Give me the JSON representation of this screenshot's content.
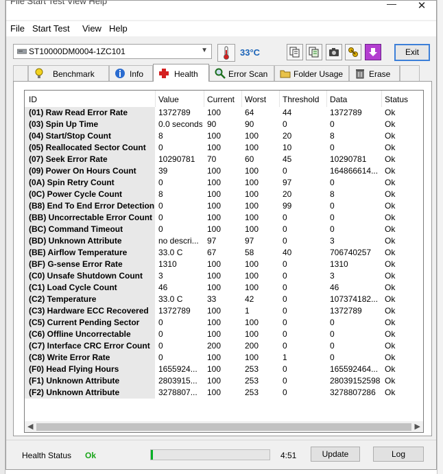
{
  "window": {
    "title": "File  Start Test  View  Help"
  },
  "menu": [
    "File",
    "Start Test",
    "View",
    "Help"
  ],
  "toolbar": {
    "drive": "ST10000DM0004-1ZC101",
    "temperature": "33°C",
    "exit_label": "Exit"
  },
  "tabs": [
    "Benchmark",
    "Info",
    "Health",
    "Error Scan",
    "Folder Usage",
    "Erase"
  ],
  "active_tab": "Health",
  "table": {
    "columns": [
      "ID",
      "Value",
      "Current",
      "Worst",
      "Threshold",
      "Data",
      "Status"
    ],
    "rows": [
      [
        "(01) Raw Read Error Rate",
        "1372789",
        "100",
        "64",
        "44",
        "1372789",
        "Ok"
      ],
      [
        "(03) Spin Up Time",
        "0.0 seconds",
        "90",
        "90",
        "0",
        "0",
        "Ok"
      ],
      [
        "(04) Start/Stop Count",
        "8",
        "100",
        "100",
        "20",
        "8",
        "Ok"
      ],
      [
        "(05) Reallocated Sector Count",
        "0",
        "100",
        "100",
        "10",
        "0",
        "Ok"
      ],
      [
        "(07) Seek Error Rate",
        "10290781",
        "70",
        "60",
        "45",
        "10290781",
        "Ok"
      ],
      [
        "(09) Power On Hours Count",
        "39",
        "100",
        "100",
        "0",
        "164866614...",
        "Ok"
      ],
      [
        "(0A) Spin Retry Count",
        "0",
        "100",
        "100",
        "97",
        "0",
        "Ok"
      ],
      [
        "(0C) Power Cycle Count",
        "8",
        "100",
        "100",
        "20",
        "8",
        "Ok"
      ],
      [
        "(B8) End To End Error Detection",
        "0",
        "100",
        "100",
        "99",
        "0",
        "Ok"
      ],
      [
        "(BB) Uncorrectable Error Count",
        "0",
        "100",
        "100",
        "0",
        "0",
        "Ok"
      ],
      [
        "(BC) Command Timeout",
        "0",
        "100",
        "100",
        "0",
        "0",
        "Ok"
      ],
      [
        "(BD) Unknown Attribute",
        "no descri...",
        "97",
        "97",
        "0",
        "3",
        "Ok"
      ],
      [
        "(BE) Airflow Temperature",
        "33.0 C",
        "67",
        "58",
        "40",
        "706740257",
        "Ok"
      ],
      [
        "(BF) G-sense Error Rate",
        "1310",
        "100",
        "100",
        "0",
        "1310",
        "Ok"
      ],
      [
        "(C0) Unsafe Shutdown Count",
        "3",
        "100",
        "100",
        "0",
        "3",
        "Ok"
      ],
      [
        "(C1) Load Cycle Count",
        "46",
        "100",
        "100",
        "0",
        "46",
        "Ok"
      ],
      [
        "(C2) Temperature",
        "33.0 C",
        "33",
        "42",
        "0",
        "107374182...",
        "Ok"
      ],
      [
        "(C3) Hardware ECC Recovered",
        "1372789",
        "100",
        "1",
        "0",
        "1372789",
        "Ok"
      ],
      [
        "(C5) Current Pending Sector",
        "0",
        "100",
        "100",
        "0",
        "0",
        "Ok"
      ],
      [
        "(C6) Offline Uncorrectable",
        "0",
        "100",
        "100",
        "0",
        "0",
        "Ok"
      ],
      [
        "(C7) Interface CRC Error Count",
        "0",
        "200",
        "200",
        "0",
        "0",
        "Ok"
      ],
      [
        "(C8) Write Error Rate",
        "0",
        "100",
        "100",
        "1",
        "0",
        "Ok"
      ],
      [
        "(F0) Head Flying Hours",
        "1655924...",
        "100",
        "253",
        "0",
        "165592464...",
        "Ok"
      ],
      [
        "(F1) Unknown Attribute",
        "2803915...",
        "100",
        "253",
        "0",
        "28039152598",
        "Ok"
      ],
      [
        "(F2) Unknown Attribute",
        "3278807...",
        "100",
        "253",
        "0",
        "3278807286",
        "Ok"
      ]
    ]
  },
  "status": {
    "label": "Health Status",
    "value": "Ok",
    "value_color": "#1aa51a",
    "progress_fraction": 0.02,
    "time": "4:51",
    "update_label": "Update",
    "log_label": "Log"
  }
}
